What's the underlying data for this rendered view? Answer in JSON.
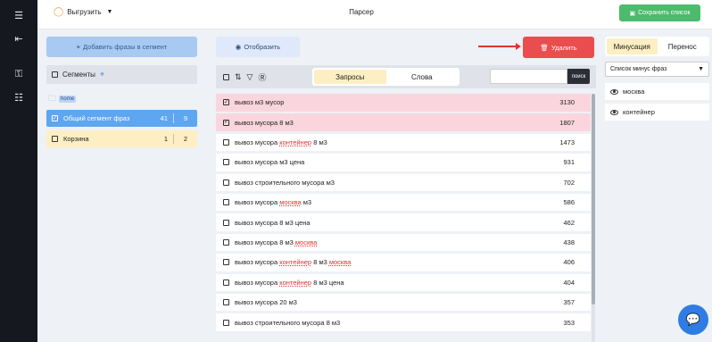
{
  "header": {
    "export_label": "Выгрузить",
    "title": "Парсер",
    "save_label": "Сохранить список"
  },
  "left": {
    "add_phrases_label": "Добавить фразы в сегмент",
    "segments_label": "Сегменты",
    "folder_tag": "home",
    "segments": [
      {
        "name": "Общий сегмент фраз",
        "count1": "41",
        "count2": "9",
        "checked": true
      },
      {
        "name": "Корзина",
        "count1": "1",
        "count2": "2",
        "checked": false
      }
    ]
  },
  "middle": {
    "show_label": "Отобразить",
    "delete_label": "Удалить",
    "tabs": [
      "Запросы",
      "Слова"
    ],
    "active_tab": "Запросы",
    "search_placeholder": "",
    "search_button": "поиск",
    "rows": [
      {
        "parts": [
          [
            "вывоз м3 мусор",
            false
          ]
        ],
        "value": "3130",
        "selected": true
      },
      {
        "parts": [
          [
            "вывоз мусора 8 м3",
            false
          ]
        ],
        "value": "1807",
        "selected": true
      },
      {
        "parts": [
          [
            "вывоз мусора ",
            false
          ],
          [
            "контейнер",
            true
          ],
          [
            " 8 м3",
            false
          ]
        ],
        "value": "1473",
        "selected": false
      },
      {
        "parts": [
          [
            "вывоз мусора м3 цена",
            false
          ]
        ],
        "value": "931",
        "selected": false
      },
      {
        "parts": [
          [
            "вывоз строительного мусора м3",
            false
          ]
        ],
        "value": "702",
        "selected": false
      },
      {
        "parts": [
          [
            "вывоз мусора ",
            false
          ],
          [
            "москва",
            true
          ],
          [
            " м3",
            false
          ]
        ],
        "value": "586",
        "selected": false
      },
      {
        "parts": [
          [
            "вывоз мусора 8 м3 цена",
            false
          ]
        ],
        "value": "462",
        "selected": false
      },
      {
        "parts": [
          [
            "вывоз мусора 8 м3 ",
            false
          ],
          [
            "москва",
            true
          ]
        ],
        "value": "438",
        "selected": false
      },
      {
        "parts": [
          [
            "вывоз мусора ",
            false
          ],
          [
            "контейнер",
            true
          ],
          [
            " 8 м3 ",
            false
          ],
          [
            "москва",
            true
          ]
        ],
        "value": "406",
        "selected": false
      },
      {
        "parts": [
          [
            "вывоз мусора ",
            false
          ],
          [
            "контейнер",
            true
          ],
          [
            " 8 м3 цена",
            false
          ]
        ],
        "value": "404",
        "selected": false
      },
      {
        "parts": [
          [
            "вывоз мусора 20 м3",
            false
          ]
        ],
        "value": "357",
        "selected": false
      },
      {
        "parts": [
          [
            "вывоз строительного мусора 8 м3",
            false
          ]
        ],
        "value": "353",
        "selected": false
      }
    ]
  },
  "right": {
    "tabs": [
      "Минусация",
      "Перенос"
    ],
    "active_tab": "Минусация",
    "list_select": "Список минус фраз",
    "items": [
      "москва",
      "контейнер"
    ]
  },
  "colors": {
    "leftbar": "#15191f",
    "save_green": "#4cbb6c",
    "delete_red": "#ea4d4d",
    "selected_row": "#fad5de",
    "active_segment": "#5fa6f0",
    "highlight_yellow": "#fdefc3",
    "keyword_red": "#d33333"
  }
}
